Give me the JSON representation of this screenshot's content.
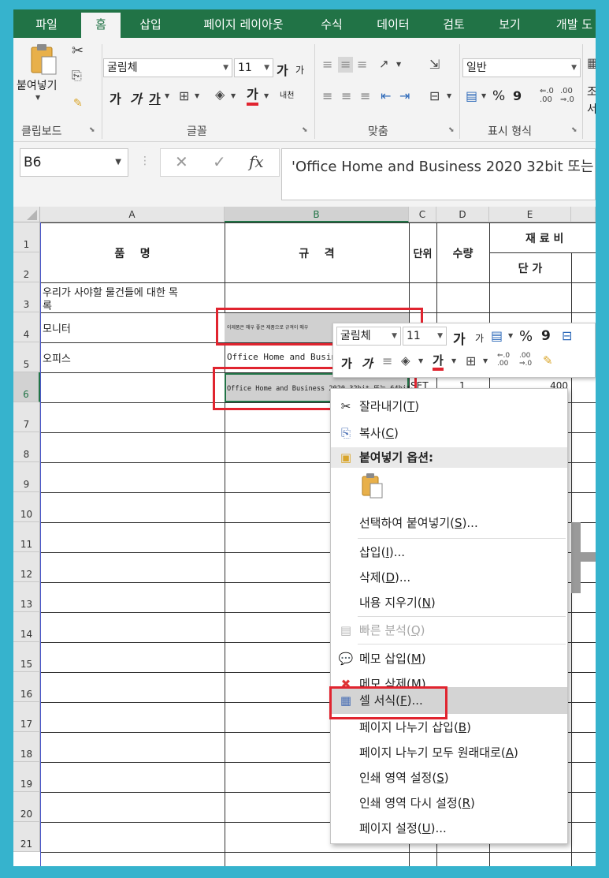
{
  "tabs": [
    "파일",
    "홈",
    "삽입",
    "페이지 레이아웃",
    "수식",
    "데이터",
    "검토",
    "보기",
    "개발 도"
  ],
  "active_tab": "홈",
  "ribbon": {
    "paste_label": "붙여넣기",
    "font_name": "굴림체",
    "font_size": "11",
    "grow_font": "가",
    "shrink_font": "가",
    "bold": "가",
    "italic": "가",
    "underline": "가",
    "font_color": "가",
    "phonetic": "내천",
    "number_format": "일반",
    "percent": "%",
    "comma": "9",
    "cond_label": "조",
    "cond_label2": "서",
    "groups": {
      "clipboard": "클립보드",
      "font": "글꼴",
      "alignment": "맞춤",
      "number": "표시 형식"
    }
  },
  "formula_bar": {
    "name_box": "B6",
    "cancel": "✕",
    "enter": "✓",
    "fx": "fx",
    "formula": "'Office Home and Business 2020 32bit 또는"
  },
  "columns": [
    "A",
    "B",
    "C",
    "D",
    "E"
  ],
  "rows": [
    "1",
    "2",
    "3",
    "4",
    "5",
    "6",
    "7",
    "8",
    "9",
    "10",
    "11",
    "12",
    "13",
    "14",
    "15",
    "16",
    "17",
    "18",
    "19",
    "20",
    "21"
  ],
  "cells": {
    "a_header": "품    명",
    "b_header": "규    격",
    "c_header": "단위",
    "d_header": "수량",
    "e_header": "재 료 비",
    "e_sub": "단 가",
    "a3_line1": "우리가 사야할 물건들에 대한 목",
    "a3_line2": "록",
    "a4": "모니터",
    "b4": "이제품은 매우 좋은 제품으로 규격이 매우",
    "a5": "오피스",
    "b5": "Office Home and Busine",
    "b6": "Office Home and Business 2020 32bit 또는 64bit",
    "c6": "SET",
    "d6": "1",
    "e6": "400"
  },
  "mini_toolbar": {
    "font_name": "굴림체",
    "font_size": "11",
    "grow": "가",
    "shrink": "가",
    "percent": "%",
    "comma": "9",
    "bold": "가",
    "italic": "가",
    "font_color": "가"
  },
  "context_menu": {
    "cut": "잘라내기",
    "cut_key": "T",
    "copy": "복사",
    "copy_key": "C",
    "paste_options": "붙여넣기 옵션:",
    "paste_special": "선택하여 붙여넣기",
    "paste_special_key": "S",
    "insert": "삽입",
    "insert_key": "I",
    "delete": "삭제",
    "delete_key": "D",
    "clear": "내용 지우기",
    "clear_key": "N",
    "quick_analysis": "빠른 분석",
    "quick_analysis_key": "Q",
    "insert_comment": "메모 삽입",
    "insert_comment_key": "M",
    "delete_comment": "메모 삭제",
    "delete_comment_key": "M",
    "format_cells": "셀 서식",
    "format_cells_key": "F",
    "insert_page_break": "페이지 나누기 삽입",
    "insert_page_break_key": "B",
    "reset_page_breaks": "페이지 나누기 모두 원래대로",
    "reset_page_breaks_key": "A",
    "set_print_area": "인쇄 영역 설정",
    "set_print_area_key": "S",
    "reset_print_area": "인쇄 영역 다시 설정",
    "reset_print_area_key": "R",
    "page_setup": "페이지 설정",
    "page_setup_key": "U"
  },
  "accent_color": "#217346",
  "highlight_color": "#e0242f"
}
